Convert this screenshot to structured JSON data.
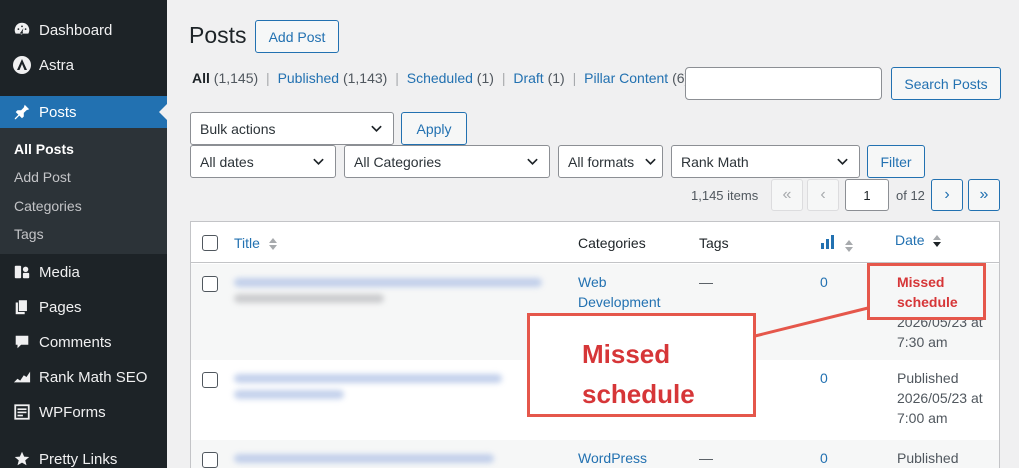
{
  "sidebar": {
    "items": [
      {
        "label": "Dashboard",
        "icon": "dashboard-icon"
      },
      {
        "label": "Astra",
        "icon": "astra-icon"
      },
      {
        "label": "Posts",
        "icon": "pin-icon"
      },
      {
        "label": "Media",
        "icon": "media-icon"
      },
      {
        "label": "Pages",
        "icon": "pages-icon"
      },
      {
        "label": "Comments",
        "icon": "comments-icon"
      },
      {
        "label": "Rank Math SEO",
        "icon": "rank-math-icon"
      },
      {
        "label": "WPForms",
        "icon": "wpforms-icon"
      },
      {
        "label": "Pretty Links",
        "icon": "star-icon"
      }
    ],
    "submenu": [
      "All Posts",
      "Add Post",
      "Categories",
      "Tags"
    ]
  },
  "header": {
    "title": "Posts",
    "add_post_label": "Add Post"
  },
  "views": {
    "all": "All",
    "all_count": "(1,145)",
    "published": "Published",
    "published_count": "(1,143)",
    "scheduled": "Scheduled",
    "scheduled_count": "(1)",
    "draft": "Draft",
    "draft_count": "(1)",
    "pillar": "Pillar Content",
    "pillar_count": "(6)",
    "separator": "|"
  },
  "search": {
    "value": "",
    "button_label": "Search Posts"
  },
  "filters": {
    "bulk_actions": "Bulk actions",
    "apply_label": "Apply",
    "dates": "All dates",
    "categories": "All Categories",
    "formats": "All formats",
    "rank_math": "Rank Math",
    "filter_label": "Filter"
  },
  "pagination": {
    "items": "1,145 items",
    "first": "«",
    "prev": "‹",
    "current": "1",
    "of": "of 12",
    "next": "›",
    "last": "»"
  },
  "table": {
    "columns": {
      "title": "Title",
      "categories": "Categories",
      "tags": "Tags",
      "date": "Date"
    },
    "rows": [
      {
        "category_1": "Web",
        "category_2": "Development",
        "tags": "—",
        "count": "0",
        "date_status_1": "Missed",
        "date_status_2": "schedule",
        "date_1": "2026/05/23 at",
        "date_2": "7:30 am"
      },
      {
        "category_1": "",
        "category_2": "",
        "tags": "",
        "count": "0",
        "date_status_1": "Published",
        "date_status_2": "",
        "date_1": "2026/05/23 at",
        "date_2": "7:00 am"
      },
      {
        "category_1": "WordPress",
        "category_2": "",
        "tags": "—",
        "count": "0",
        "date_status_1": "Published",
        "date_status_2": "",
        "date_1": "",
        "date_2": ""
      }
    ]
  },
  "annotation": {
    "line_1": "Missed",
    "line_2": "schedule",
    "color": "#e5574b"
  },
  "colors": {
    "sidebar_bg": "#1d2327",
    "accent": "#2271b1",
    "missed_red": "#d63638"
  }
}
